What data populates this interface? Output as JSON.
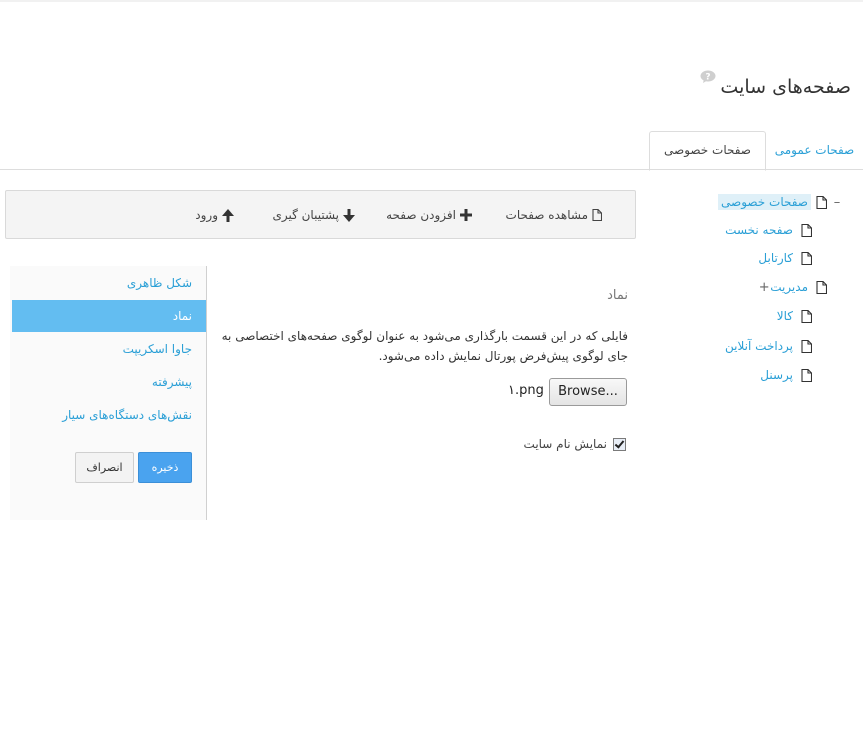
{
  "header": {
    "title": "صفحه‌های سایت",
    "help_icon": "question-bubble-icon"
  },
  "tabs": [
    {
      "label": "صفحات عمومی",
      "active": false
    },
    {
      "label": "صفحات خصوصی",
      "active": true
    }
  ],
  "toolbar": {
    "view_pages": "مشاهده صفحات",
    "add_page": "افزودن صفحه",
    "backup": "پشتیبان گیری",
    "login": "ورود"
  },
  "tree": {
    "root": {
      "label": "صفحات خصوصی",
      "toggle": "–"
    },
    "items": [
      {
        "label": "صفحه نخست"
      },
      {
        "label": "کارتابل"
      },
      {
        "label": "مدیریت",
        "toggle": "+"
      },
      {
        "label": "کالا"
      },
      {
        "label": "پرداخت آنلاین"
      },
      {
        "label": "پرسنل"
      }
    ]
  },
  "sidebar": {
    "items": [
      {
        "label": "شکل ظاهری"
      },
      {
        "label": "نماد",
        "active": true
      },
      {
        "label": "جاوا اسکریپت"
      },
      {
        "label": "پیشرفته"
      },
      {
        "label": "نقش‌های دستگاه‌های سیار"
      }
    ],
    "save_label": "ذخیره",
    "cancel_label": "انصراف"
  },
  "content": {
    "section_title": "نماد",
    "description": "فایلی که در این قسمت بارگذاری می‌شود به عنوان لوگوی صفحه‌های اختصاصی به جای لوگوی پیش‌فرض پورتال نمایش داده می‌شود.",
    "browse_label": "Browse...",
    "file_name": "۱.png",
    "show_site_name_label": "نمایش نام سایت",
    "show_site_name_checked": true
  },
  "colors": {
    "accent": "#2a9fd6",
    "active_nav": "#63bdf1",
    "save_button": "#4aa3ef"
  }
}
